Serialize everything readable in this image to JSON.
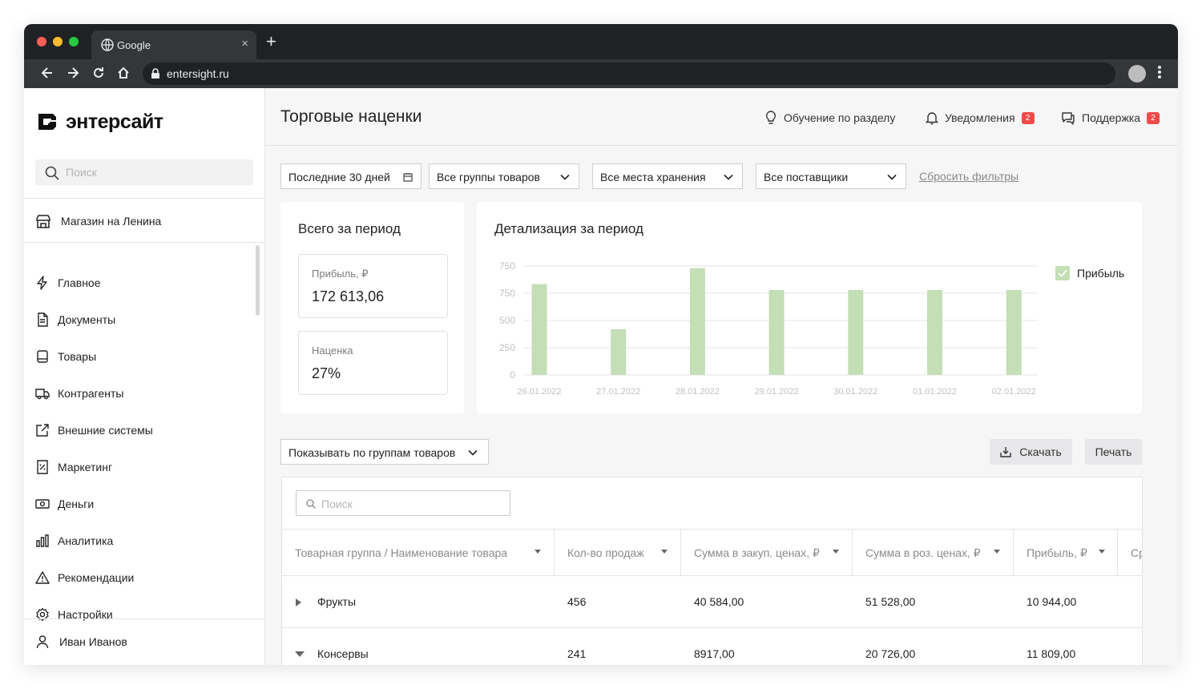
{
  "browser": {
    "tab_title": "Google",
    "tab_close": "×",
    "new_tab": "+",
    "url": "entersight.ru"
  },
  "sidebar": {
    "logo_text": "энтерсайт",
    "search_placeholder": "Поиск",
    "store_name": "Магазин на Ленина",
    "items": [
      {
        "label": "Главное",
        "icon": "lightning-icon"
      },
      {
        "label": "Документы",
        "icon": "document-icon"
      },
      {
        "label": "Товары",
        "icon": "product-icon"
      },
      {
        "label": "Контрагенты",
        "icon": "truck-icon"
      },
      {
        "label": "Внешние системы",
        "icon": "external-link-icon"
      },
      {
        "label": "Маркетинг",
        "icon": "discount-icon"
      },
      {
        "label": "Деньги",
        "icon": "money-icon"
      },
      {
        "label": "Аналитика",
        "icon": "bar-chart-icon"
      },
      {
        "label": "Рекомендации",
        "icon": "warning-icon"
      },
      {
        "label": "Настройки",
        "icon": "gear-icon"
      }
    ],
    "user_name": "Иван Иванов"
  },
  "header": {
    "title": "Торговые наценки",
    "learn_label": "Обучение по разделу",
    "notifications_label": "Уведомления",
    "notifications_count": "2",
    "support_label": "Поддержка",
    "support_count": "2"
  },
  "filters": {
    "period": "Последние 30 дней",
    "groups": "Все группы товаров",
    "storage": "Все места хранения",
    "suppliers": "Все поставщики",
    "reset": "Сбросить фильтры"
  },
  "summary": {
    "title": "Всего за период",
    "profit_label": "Прибыль, ₽",
    "profit_value": "172 613,06",
    "markup_label": "Наценка",
    "markup_value": "27%"
  },
  "chart_title": "Детализация за период",
  "chart_data": {
    "type": "bar",
    "categories": [
      "26.01.2022",
      "27.01.2022",
      "28.01.2022",
      "29.01.2022",
      "30.01.2022",
      "01.01.2022",
      "02.01.2022"
    ],
    "series": [
      {
        "name": "Прибыль",
        "values": [
          625,
          315,
          735,
          585,
          585,
          585,
          585
        ],
        "color": "#c4deb6"
      }
    ],
    "y_ticks": [
      "0",
      "250",
      "500",
      "750",
      "750"
    ],
    "ylim": [
      0,
      750
    ],
    "grid": true,
    "legend": "right"
  },
  "table_controls": {
    "group_select": "Показывать по группам товаров",
    "download": "Скачать",
    "print": "Печать",
    "search_placeholder": "Поиск"
  },
  "table": {
    "columns": [
      "Товарная группа / Наименование товара",
      "Кол-во продаж",
      "Сумма в закуп. ценах, ₽",
      "Сумма в роз. ценах, ₽",
      "Прибыль, ₽",
      "Ср"
    ],
    "rows": [
      {
        "name": "Фрукты",
        "qty": "456",
        "purchase": "40 584,00",
        "retail": "51 528,00",
        "profit": "10 944,00",
        "expanded": false
      },
      {
        "name": "Консервы",
        "qty": "241",
        "purchase": "8917,00",
        "retail": "20 726,00",
        "profit": "11 809,00",
        "expanded": true
      }
    ]
  }
}
